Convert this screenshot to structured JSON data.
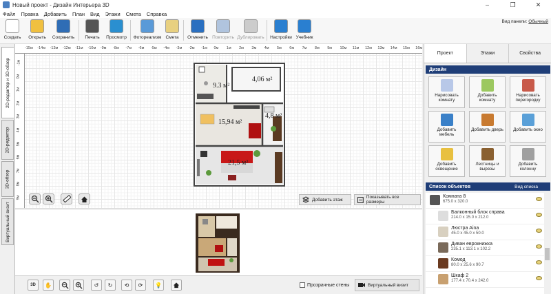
{
  "window": {
    "title": "Новый проект - Дизайн Интерьера 3D",
    "controls": [
      "–",
      "❐",
      "✕"
    ]
  },
  "menu": [
    "Файл",
    "Правка",
    "Добавить",
    "План",
    "Вид",
    "Этажи",
    "Смета",
    "Справка"
  ],
  "toolbar": {
    "buttons": [
      {
        "label": "Создать",
        "icon": "document-icon",
        "color": "#ffffff"
      },
      {
        "label": "Открыть",
        "icon": "folder-icon",
        "color": "#f0c040"
      },
      {
        "label": "Сохранить",
        "icon": "floppy-icon",
        "color": "#2f6db5"
      },
      {
        "label": "Печать",
        "icon": "printer-icon",
        "color": "#555555"
      },
      {
        "label": "Просмотр",
        "icon": "monitor-icon",
        "color": "#2a8fd0"
      },
      {
        "label": "Фотореализм",
        "icon": "photo-icon",
        "color": "#5a9ad8"
      },
      {
        "label": "Смета",
        "icon": "notepad-icon",
        "color": "#e8d080"
      },
      {
        "label": "Отменить",
        "icon": "undo-icon",
        "color": "#2a6fc0"
      },
      {
        "label": "Повторить",
        "icon": "redo-icon",
        "color": "#b0c4de"
      },
      {
        "label": "Дублировать",
        "icon": "duplicate-icon",
        "color": "#cccccc"
      },
      {
        "label": "Настройки",
        "icon": "gear-icon",
        "color": "#2a7fd0"
      },
      {
        "label": "Учебник",
        "icon": "help-icon",
        "color": "#2a7fd0"
      }
    ],
    "panel_view_label": "Вид панели:",
    "panel_view_value": "Обычный"
  },
  "left_tabs": [
    "2D-редактор и 3D-обзор",
    "2D-редактор",
    "3D-обзор",
    "Виртуальный визит"
  ],
  "ruler": {
    "top": [
      "-15м",
      "-14м",
      "-13м",
      "-12м",
      "-11м",
      "-10м",
      "-9м",
      "-8м",
      "-7м",
      "-6м",
      "-5м",
      "-4м",
      "-3м",
      "-2м",
      "-1м",
      "0м",
      "1м",
      "2м",
      "3м",
      "4м",
      "5м",
      "6м",
      "7м",
      "8м",
      "9м",
      "10м",
      "11м",
      "12м",
      "13м",
      "14м",
      "15м",
      "16м"
    ],
    "left": [
      "-1м",
      "0м",
      "1м",
      "2м",
      "3м",
      "4м",
      "5м",
      "6м",
      "7м",
      "8м",
      "9м"
    ]
  },
  "plan": {
    "rooms": [
      {
        "label": "9.3 м²"
      },
      {
        "label": "4,06 м²"
      },
      {
        "label": "15,94 м²"
      },
      {
        "label": "4,8 м²"
      },
      {
        "label": "21,5 м²"
      }
    ]
  },
  "editor_buttons": {
    "add_floor": "Добавить этаж",
    "show_all_sizes": "Показывать все размеры"
  },
  "bottom_bar": {
    "transparent_walls": "Прозрачные стены",
    "virtual_visit": "Виртуальный визит",
    "mode_label": "3D"
  },
  "right_panel": {
    "tabs": [
      "Проект",
      "Этажи",
      "Свойства"
    ],
    "design_header": "Дизайн",
    "design_buttons": [
      {
        "label": "Нарисовать комнату",
        "icon": "draw-room-icon",
        "color": "#b8c8e8"
      },
      {
        "label": "Добавить комнату",
        "icon": "add-room-icon",
        "color": "#9cc860"
      },
      {
        "label": "Нарисовать перегородку",
        "icon": "brick-wall-icon",
        "color": "#c85a4a"
      },
      {
        "label": "Добавить мебель",
        "icon": "chair-icon",
        "color": "#3a80c8"
      },
      {
        "label": "Добавить дверь",
        "icon": "door-icon",
        "color": "#c87a30"
      },
      {
        "label": "Добавить окно",
        "icon": "window-icon",
        "color": "#5aa0d8"
      },
      {
        "label": "Добавить освещение",
        "icon": "lamp-icon",
        "color": "#e8c040"
      },
      {
        "label": "Лестницы и вырезы",
        "icon": "stairs-icon",
        "color": "#8a6030"
      },
      {
        "label": "Добавить колонну",
        "icon": "column-icon",
        "color": "#a0a0a0"
      }
    ],
    "objects_header": "Список объектов",
    "objects_sub": "Вид списка",
    "objects": [
      {
        "name": "Комната 8",
        "dims": "675.0 x 320.0",
        "color": "#555555"
      },
      {
        "name": "Балконный блок справа",
        "dims": "214.0 x 15.0 x 212.0",
        "color": "#dddddd"
      },
      {
        "name": "Люстра Aina",
        "dims": "45.0 x 45.0 x 50.0",
        "color": "#d8d0c0"
      },
      {
        "name": "Диван еврокнижка",
        "dims": "235.1 x 113.1 x 102.2",
        "color": "#7a6a5a"
      },
      {
        "name": "Комод",
        "dims": "80.0 x 25.6 x 90.7",
        "color": "#6a3a20"
      },
      {
        "name": "Шкаф 2",
        "dims": "177.4 x 70.4 x 242.0",
        "color": "#c8a070"
      }
    ]
  }
}
